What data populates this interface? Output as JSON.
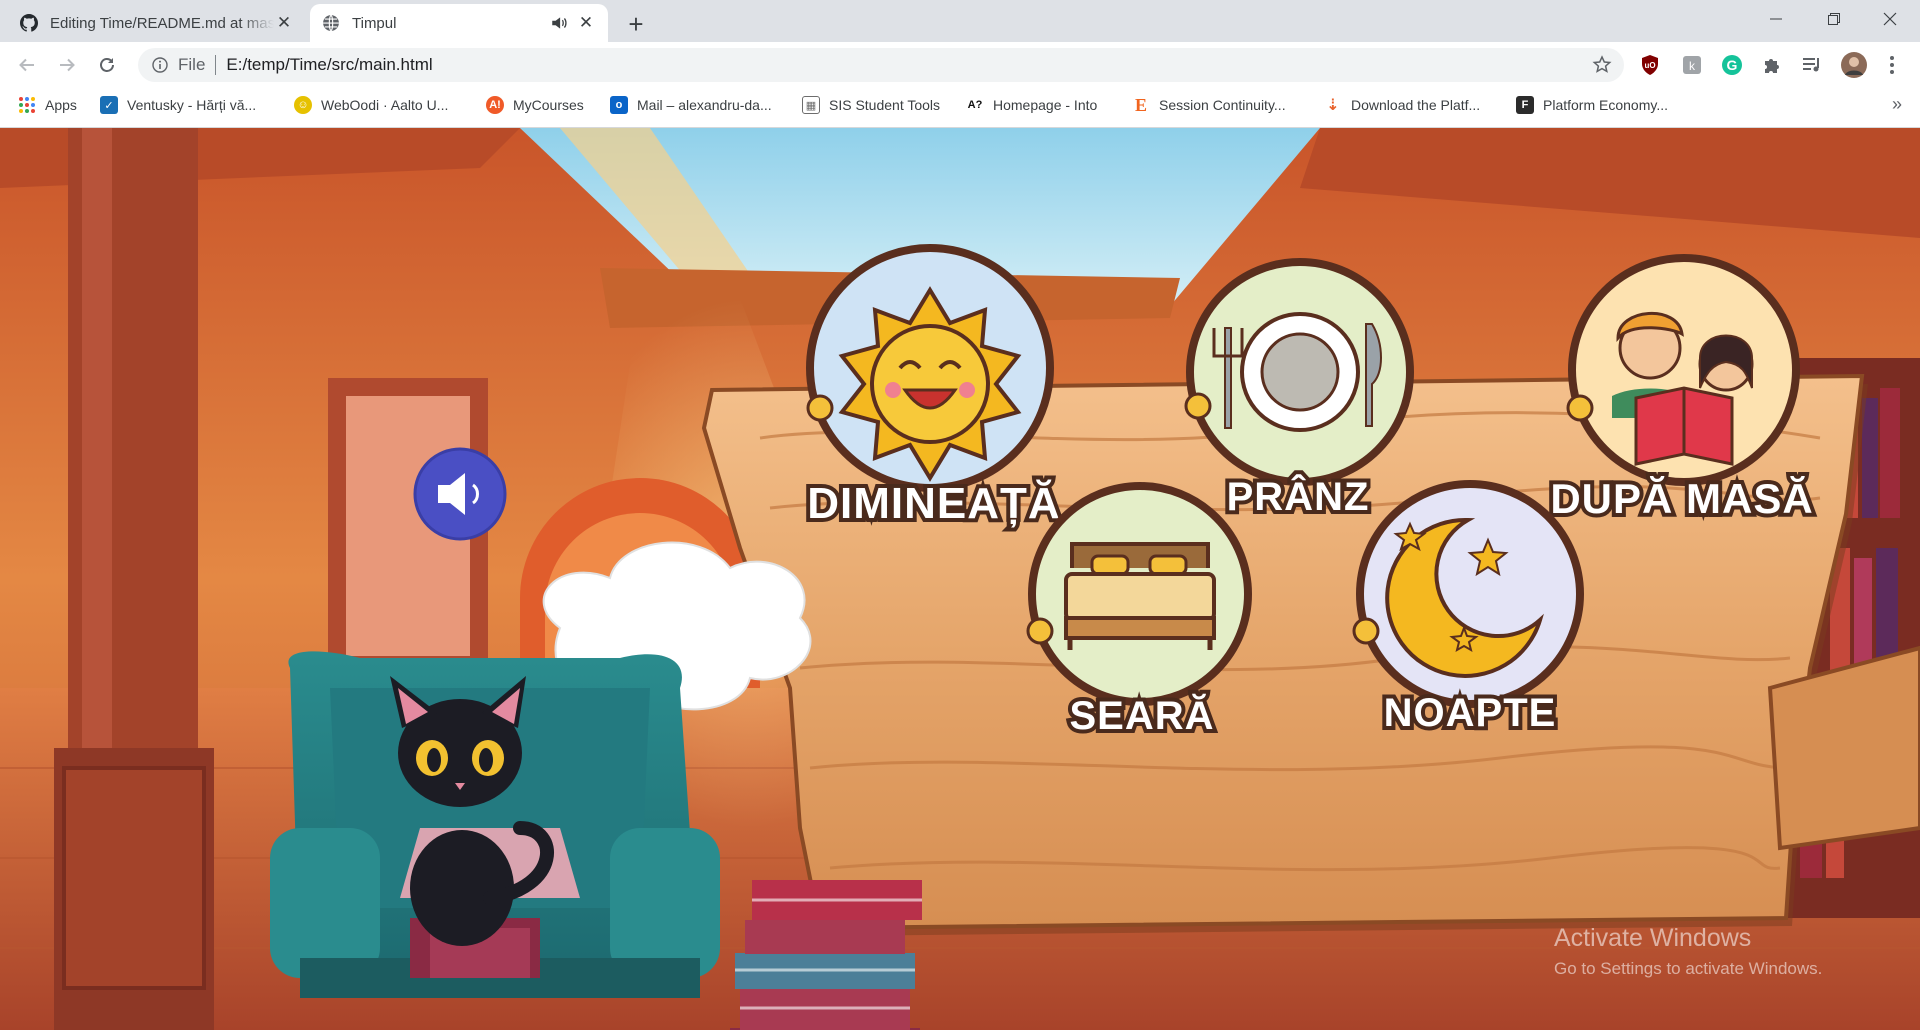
{
  "tabs": [
    {
      "title": "Editing Time/README.md at mas",
      "icon": "github-icon",
      "active": false
    },
    {
      "title": "Timpul",
      "icon": "globe-icon",
      "active": true,
      "audio": "speaker-icon"
    }
  ],
  "toolbar": {
    "scheme": "File",
    "url": "E:/temp/Time/src/main.html"
  },
  "bookmarks": [
    {
      "label": "Apps",
      "icon": "apps-grid-icon"
    },
    {
      "label": "Ventusky - Hărți vă...",
      "icon": "ventusky-icon",
      "color": "#1a6fb5"
    },
    {
      "label": "WebOodi · Aalto U...",
      "icon": "weboodi-icon",
      "color": "#e6c100"
    },
    {
      "label": "MyCourses",
      "icon": "mycourses-icon",
      "color": "#f05a28"
    },
    {
      "label": "Mail – alexandru-da...",
      "icon": "outlook-icon",
      "color": "#0a64c8"
    },
    {
      "label": "SIS Student Tools",
      "icon": "sis-icon",
      "color": "#6d6d6d"
    },
    {
      "label": "Homepage - Into",
      "icon": "into-icon",
      "color": "#111111"
    },
    {
      "label": "Session Continuity...",
      "icon": "etsy-icon",
      "color": "#f1641e"
    },
    {
      "label": "Download the Platf...",
      "icon": "platform-icon",
      "color": "#e8622c"
    },
    {
      "label": "Platform Economy...",
      "icon": "f-icon",
      "color": "#2b2b2b"
    }
  ],
  "scene": {
    "speaker_button": "speaker-icon",
    "thought_bubble_text": "",
    "times": [
      {
        "id": "morning",
        "label": "DIMINEAȚĂ",
        "icon": "sun-icon"
      },
      {
        "id": "noon",
        "label": "PRÂNZ",
        "icon": "plate-icon"
      },
      {
        "id": "afternoon",
        "label": "DUPĂ MASĂ",
        "icon": "kids-reading-icon"
      },
      {
        "id": "evening",
        "label": "SEARĂ",
        "icon": "bed-icon"
      },
      {
        "id": "night",
        "label": "NOAPTE",
        "icon": "moon-icon"
      }
    ]
  },
  "watermark": {
    "line1": "Activate Windows",
    "line2": "Go to Settings to activate Windows."
  },
  "colors": {
    "accent_blue": "#4a4fc4",
    "sign_wood": "#e8a56a",
    "label_outline": "#4a2a1c"
  }
}
